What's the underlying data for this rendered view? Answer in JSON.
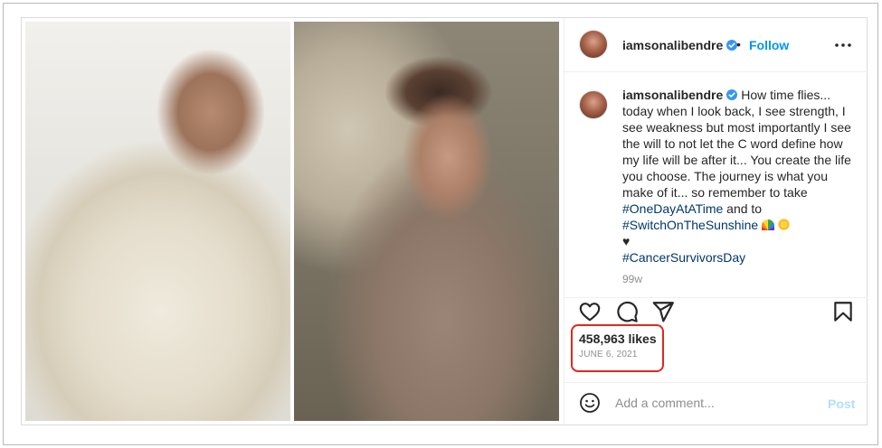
{
  "post": {
    "username": "iamsonalibendre",
    "follow_label": "Follow",
    "separator": "•",
    "caption": {
      "line1": "How time flies... today when I look back, I see strength, I see weakness but most importantly I see the will to not let the C word define how my life will be after it... You create the life you choose. The journey is what you make of it... so remember to take ",
      "tag1": "#OneDayAtATime",
      "line2": " and to ",
      "tag2": "#SwitchOnTheSunshine",
      "heart": "♥",
      "tag3": "#CancerSurvivorsDay"
    },
    "time_ago": "99w",
    "likes": "458,963 likes",
    "date": "JUNE 6, 2021",
    "comment_placeholder": "Add a comment...",
    "post_label": "Post"
  },
  "icons": {
    "verified": "verified-badge-icon",
    "more": "more-options-icon",
    "like": "heart-icon",
    "comment": "comment-icon",
    "share": "share-icon",
    "save": "bookmark-icon",
    "emoji": "emoji-smile-icon"
  },
  "colors": {
    "link_blue": "#0095f6",
    "hashtag": "#00376b",
    "verified_blue": "#3897f0",
    "highlight_red": "#e0281e",
    "muted_gray": "#8e8e8e"
  }
}
